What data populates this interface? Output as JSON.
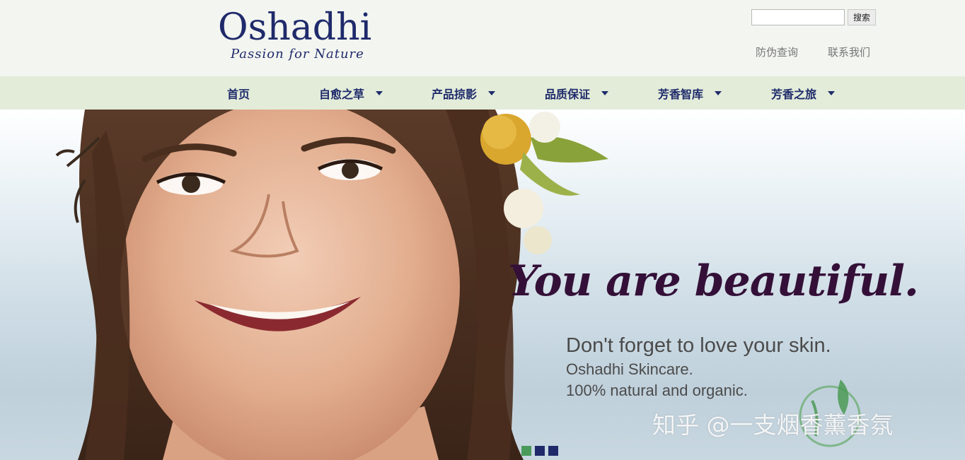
{
  "brand": {
    "title": "Oshadhi",
    "tagline": "Passion for Nature"
  },
  "search": {
    "value": "",
    "placeholder": "",
    "button_label": "搜索"
  },
  "top_links": [
    "防伪查询",
    "联系我们"
  ],
  "nav": [
    {
      "label": "首页",
      "has_dropdown": false
    },
    {
      "label": "自愈之草",
      "has_dropdown": true
    },
    {
      "label": "产品掠影",
      "has_dropdown": true
    },
    {
      "label": "品质保证",
      "has_dropdown": true
    },
    {
      "label": "芳香智库",
      "has_dropdown": true
    },
    {
      "label": "芳香之旅",
      "has_dropdown": true
    }
  ],
  "hero": {
    "headline": "You are beautiful.",
    "line1": "Don't forget to love your skin.",
    "line2": "Oshadhi Skincare.",
    "line3": "100% natural and organic.",
    "slides_count": 3,
    "active_slide": 1
  },
  "watermark": {
    "text": "知乎 @一支烟香薰香氛"
  },
  "colors": {
    "brand_navy": "#1f2a6b",
    "nav_bg": "#e2ecd9",
    "headline_purple": "#341038",
    "active_dot": "#4a9a5a"
  }
}
